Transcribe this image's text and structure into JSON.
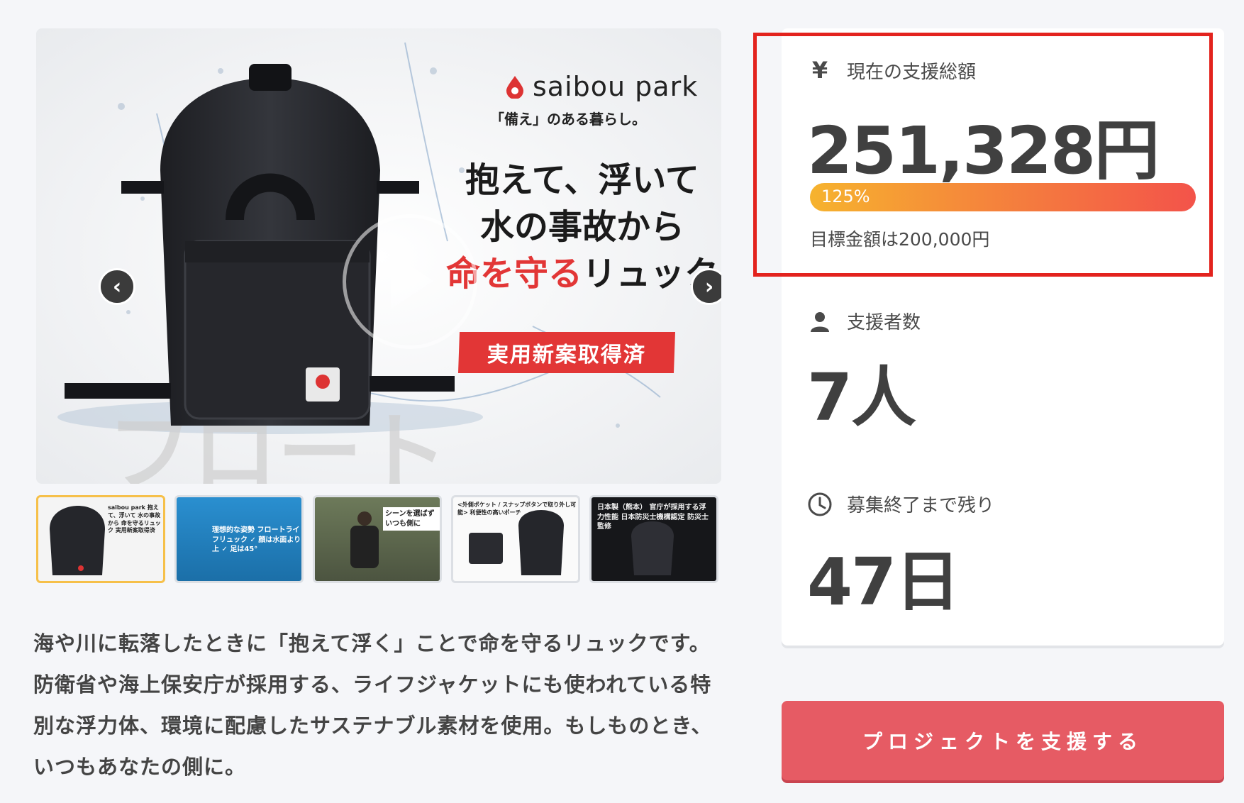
{
  "gallery": {
    "brand": "saibou park",
    "tagline": "「備え」のある暮らし。",
    "headline_1": "抱えて、浮いて",
    "headline_2": "水の事故から",
    "headline_3_red": "命を守る",
    "headline_3_rest": "リュック",
    "badge": "実用新案取得済",
    "prev_icon": "chevron-left-icon",
    "next_icon": "chevron-right-icon",
    "thumbnails": [
      {
        "caption": "saibou park 抱えて、浮いて 水の事故から 命を守るリュック 実用新案取得済"
      },
      {
        "caption": "理想的な姿勢 フロートライフリュック ✓ 顔は水面より上 ✓ 足は45°"
      },
      {
        "caption": "シーンを選ばず いつも側に"
      },
      {
        "caption": "<外側ポケット / スナップボタンで取り外し可能> 利便性の高いポーチ"
      },
      {
        "caption": "日本製（熊本） 官庁が採用する浮力性能 日本防災士機構認定 防災士監修"
      }
    ]
  },
  "description": "海や川に転落したときに「抱えて浮く」ことで命を守るリュックです。防衛省や海上保安庁が採用する、ライフジャケットにも使われている特別な浮力体、環境に配慮したサステナブル素材を使用。もしものとき、いつもあなたの側に。",
  "stats": {
    "total_icon": "¥",
    "total_label": "現在の支援総額",
    "total_value": "251,328円",
    "progress_percent": 125,
    "progress_label": "125%",
    "goal_text": "目標金額は200,000円",
    "backers_icon": "person-icon",
    "backers_label": "支援者数",
    "backers_value": "7人",
    "remaining_icon": "clock-icon",
    "remaining_label": "募集終了まで残り",
    "remaining_value": "47日"
  },
  "cta": {
    "label": "プロジェクトを支援する"
  },
  "colors": {
    "accent_red": "#e23636",
    "highlight_border": "#e3231e",
    "cta_bg": "#e65b64",
    "active_thumb_border": "#f6c04a"
  }
}
